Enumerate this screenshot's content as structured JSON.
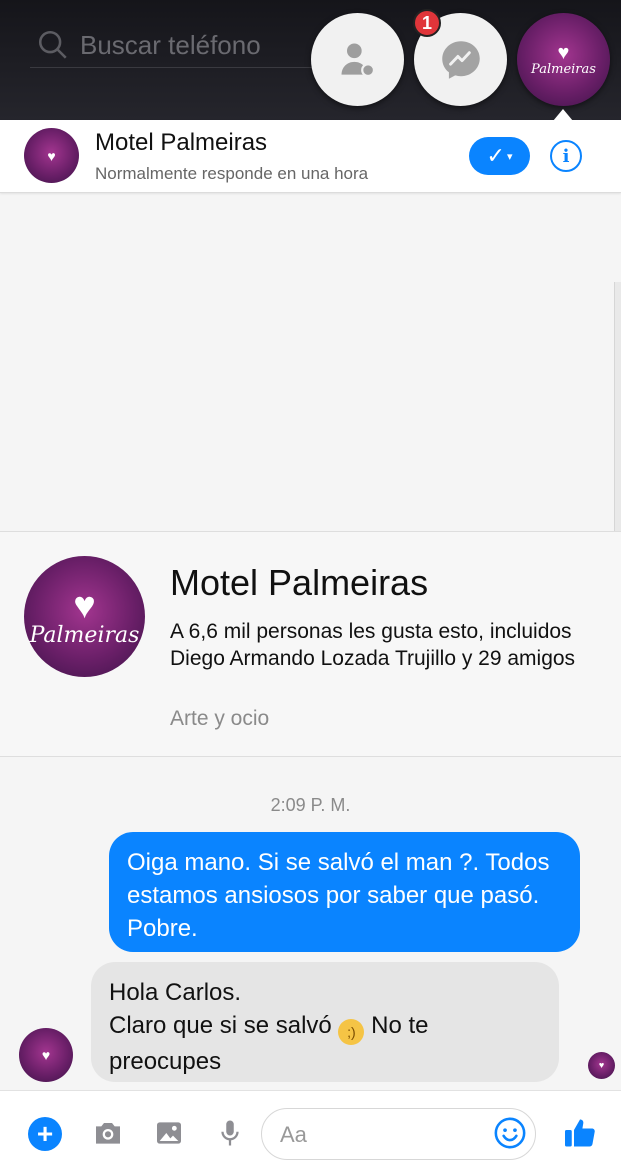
{
  "search": {
    "placeholder": "Buscar teléfono"
  },
  "chat_heads": {
    "unread_badge": "1",
    "page_logo_text": "Palmeiras"
  },
  "header": {
    "page_name": "Motel Palmeiras",
    "subtitle": "Normalmente responde en una hora"
  },
  "page_card": {
    "name": "Motel Palmeiras",
    "likes": "A 6,6 mil personas les gusta esto, incluidos Diego Armando Lozada Trujillo y 29 amigos",
    "category": "Arte y ocio"
  },
  "conversation": {
    "timestamp": "2:09 P. M.",
    "messages": [
      {
        "from": "me",
        "text": "Oiga mano. Si se salvó el man ?. Todos estamos ansiosos por saber que pasó. Pobre."
      },
      {
        "from": "page",
        "line1": "Hola Carlos.",
        "line2_before": "Claro que si se salvó",
        "line2_after": "No te preocupes"
      }
    ]
  },
  "composer": {
    "placeholder": "Aa"
  },
  "colors": {
    "accent": "#0a84ff",
    "outgoing_bubble": "#0a84ff",
    "incoming_bubble": "#e5e5e5",
    "badge": "#e0353a",
    "logo_purple": "#6a1f68"
  },
  "icons": [
    "search-icon",
    "contacts-icon",
    "messenger-icon",
    "check-icon",
    "info-icon",
    "plus-icon",
    "camera-icon",
    "image-icon",
    "microphone-icon",
    "emoji-icon",
    "thumbs-up-icon",
    "wink-emoji-icon"
  ]
}
